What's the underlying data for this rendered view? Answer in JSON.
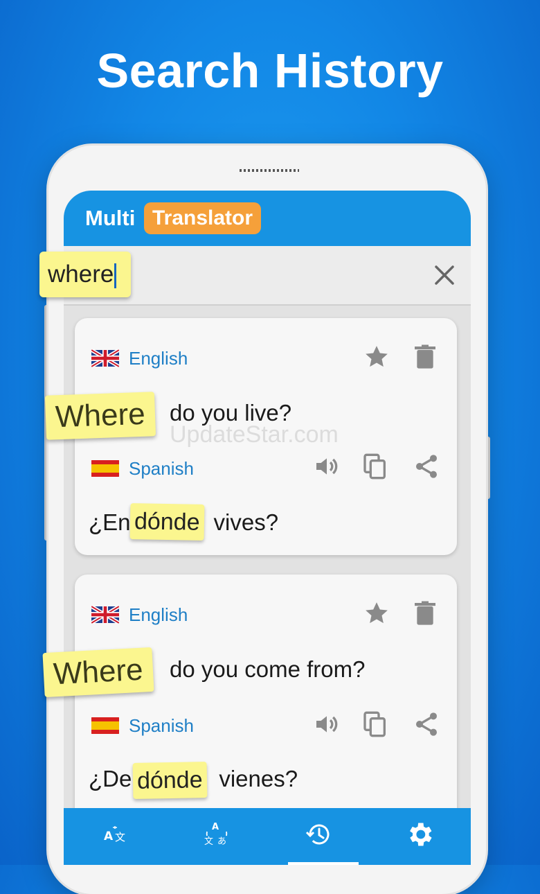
{
  "headline": "Search History",
  "app": {
    "logo_part1": "Multi",
    "logo_part2": "Translator",
    "brand_color": "#1793e2",
    "accent_color": "#f5a03a"
  },
  "search": {
    "query": "where",
    "clear_icon": "close-icon"
  },
  "history": [
    {
      "source_lang": "English",
      "source_text_highlight": "Where",
      "source_text_rest": "do you live?",
      "target_lang": "Spanish",
      "target_text_pre": "¿En",
      "target_text_highlight": "dónde",
      "target_text_post": "vives?"
    },
    {
      "source_lang": "English",
      "source_text_highlight": "Where",
      "source_text_rest": "do you come from?",
      "target_lang": "Spanish",
      "target_text_pre": "¿De",
      "target_text_highlight": "dónde",
      "target_text_post": "vienes?"
    }
  ],
  "watermark": "UpdateStar.com",
  "bottom_nav": [
    {
      "icon": "translate-icon"
    },
    {
      "icon": "conversation-translate-icon"
    },
    {
      "icon": "history-icon",
      "active": true
    },
    {
      "icon": "settings-icon"
    }
  ],
  "highlight_color": "#fbf68f"
}
